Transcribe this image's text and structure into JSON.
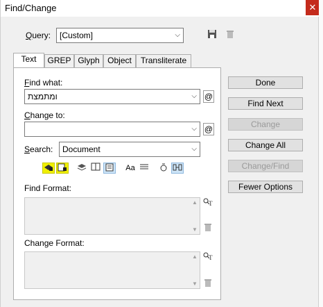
{
  "window": {
    "title": "Find/Change",
    "close_glyph": "✕"
  },
  "query": {
    "label_prefix": "",
    "label_u": "Q",
    "label_rest": "uery:",
    "value": "[Custom]"
  },
  "tabs": [
    {
      "label": "Text",
      "active": true
    },
    {
      "label": "GREP",
      "active": false
    },
    {
      "label": "Glyph",
      "active": false
    },
    {
      "label": "Object",
      "active": false
    },
    {
      "label": "Transliterate",
      "active": false
    }
  ],
  "find": {
    "label_u": "F",
    "label_rest": "ind what:",
    "value": "ומתמצת"
  },
  "change": {
    "label_u": "C",
    "label_rest": "hange to:",
    "value": ""
  },
  "search": {
    "label_u": "S",
    "label_rest": "earch:",
    "value": "Document"
  },
  "format": {
    "find_label": "Find Format:",
    "change_label": "Change Format:"
  },
  "buttons": {
    "done": "Done",
    "find_next": "Find Next",
    "change": "Change",
    "change_all": "Change All",
    "change_find": "Change/Find",
    "fewer_options": "Fewer Options"
  },
  "option_icons": {
    "case_sensitive_text": "Aa",
    "special_char": "@"
  },
  "colors": {
    "highlight": "#f0f000",
    "selected": "#cde4f7",
    "close": "#c42b1c"
  }
}
